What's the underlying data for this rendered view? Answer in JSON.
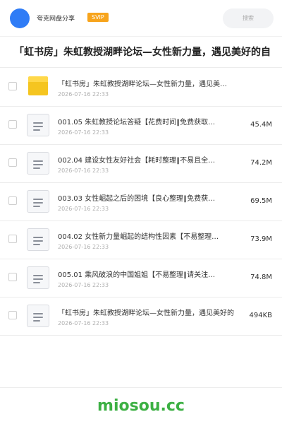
{
  "header": {
    "share_name": "夸克网盘分享",
    "badge": "SVIP",
    "search_placeholder": "搜索"
  },
  "page_title": "「虹书房」朱虹教授湖畔论坛—女性新力量，遇见美好的自",
  "files": [
    {
      "type": "folder",
      "name": "「虹书房」朱虹教授湖畔论坛—女性新力量，遇见美好的…",
      "date": "2026-07-16 22:33",
      "size": ""
    },
    {
      "type": "doc",
      "name": "001.05 朱虹教授论坛答疑【花费时间‖免费获取…",
      "date": "2026-07-16 22:33",
      "size": "45.4M"
    },
    {
      "type": "doc",
      "name": "002.04 建设女性友好社会【耗时整理‖不易且全…",
      "date": "2026-07-16 22:33",
      "size": "74.2M"
    },
    {
      "type": "doc",
      "name": "003.03 女性崛起之后的困境【良心整理‖免费获…",
      "date": "2026-07-16 22:33",
      "size": "69.5M"
    },
    {
      "type": "doc",
      "name": "004.02 女性新力量崛起的结构性因素【不易整理…",
      "date": "2026-07-16 22:33",
      "size": "73.9M"
    },
    {
      "type": "doc",
      "name": "005.01 乘风破浪的中国姐姐【不易整理‖请关注…",
      "date": "2026-07-16 22:33",
      "size": "74.8M"
    },
    {
      "type": "doc",
      "name": "「虹书房」朱虹教授湖畔论坛—女性新力量，遇见美好的",
      "date": "2026-07-16 22:33",
      "size": "494KB"
    }
  ],
  "watermark": "miosou.cc",
  "colors": {
    "avatar": "#2f7cf6",
    "svip_badge": "#f7a41c",
    "folder": "#f5c520",
    "watermark": "#3cb043"
  }
}
